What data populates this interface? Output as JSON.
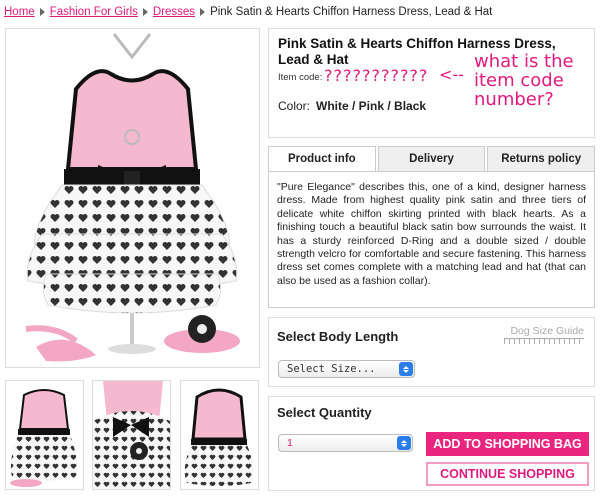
{
  "breadcrumb": {
    "home": "Home",
    "category": "Fashion For Girls",
    "subcategory": "Dresses",
    "current": "Pink Satin & Hearts Chiffon Harness Dress, Lead & Hat"
  },
  "product": {
    "title": "Pink Satin & Hearts Chiffon Harness Dress, Lead & Hat",
    "item_code_label": "Item code:",
    "item_code_value": "???????????",
    "color_label": "Color:",
    "color_value": "White / Pink / Black"
  },
  "annotation": {
    "arrow": "<--",
    "text": "what is the item code number?"
  },
  "tabs": [
    {
      "label": "Product info",
      "active": true
    },
    {
      "label": "Delivery",
      "active": false
    },
    {
      "label": "Returns policy",
      "active": false
    }
  ],
  "description": "\"Pure Elegance\" describes this, one of a kind, designer harness dress. Made from highest quality pink satin and three tiers of delicate white chiffon skirting printed with black hearts. As a finishing touch a beautiful black satin bow surrounds the waist. It has a sturdy reinforced D-Ring and a double sized / double strength velcro for comfortable and secure fastening. This harness dress set comes complete with a matching lead and hat (that can also be used as a fashion collar).",
  "size": {
    "title": "Select Body Length",
    "guide_label": "Dog Size Guide",
    "select_value": "Select Size..."
  },
  "quantity": {
    "title": "Select Quantity",
    "value": "1",
    "add_button": "ADD TO SHOPPING BAG",
    "continue_button": "CONTINUE SHOPPING"
  },
  "colors": {
    "accent_pink": "#e0197d",
    "dress_pink": "#f4b8cf",
    "select_blue": "#2b7de9"
  }
}
